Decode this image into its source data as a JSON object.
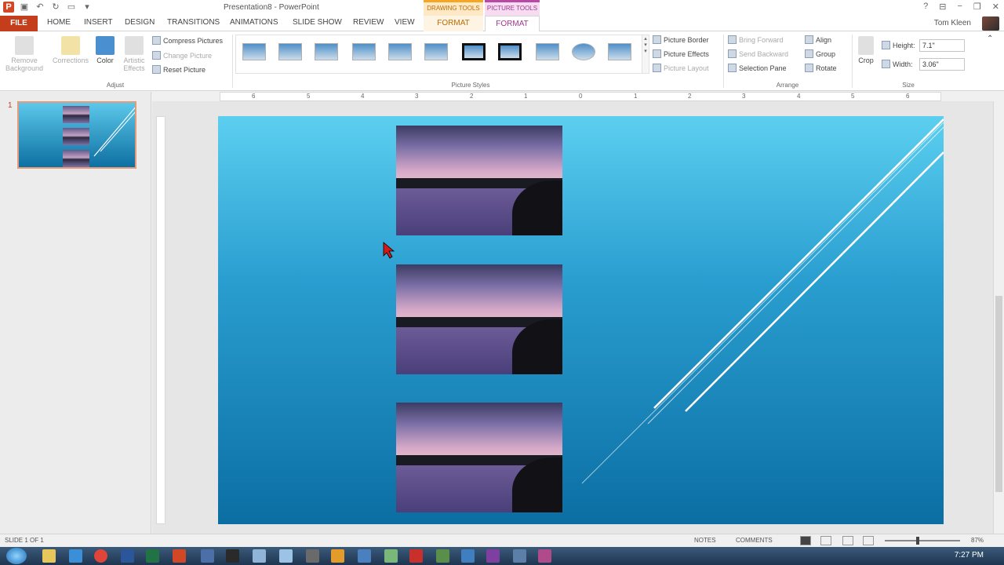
{
  "title_bar": {
    "window_title": "Presentation8 - PowerPoint",
    "ctx_drawing_tools": "DRAWING TOOLS",
    "ctx_picture_tools": "PICTURE TOOLS",
    "help": "?",
    "minimize": "−",
    "restore": "❐",
    "close": "✕"
  },
  "tabs": {
    "file": "FILE",
    "home": "HOME",
    "insert": "INSERT",
    "design": "DESIGN",
    "transitions": "TRANSITIONS",
    "animations": "ANIMATIONS",
    "slide_show": "SLIDE SHOW",
    "review": "REVIEW",
    "view": "VIEW",
    "format_drawing": "FORMAT",
    "format_picture": "FORMAT",
    "user_name": "Tom Kleen"
  },
  "ribbon": {
    "adjust": {
      "remove_background": "Remove Background",
      "corrections": "Corrections",
      "color": "Color",
      "artistic_effects": "Artistic Effects",
      "compress_pictures": "Compress Pictures",
      "change_picture": "Change Picture",
      "reset_picture": "Reset Picture",
      "label": "Adjust"
    },
    "picture_styles": {
      "label": "Picture Styles",
      "picture_border": "Picture Border",
      "picture_effects": "Picture Effects",
      "picture_layout": "Picture Layout"
    },
    "arrange": {
      "label": "Arrange",
      "bring_forward": "Bring Forward",
      "send_backward": "Send Backward",
      "selection_pane": "Selection Pane",
      "align": "Align",
      "group": "Group",
      "rotate": "Rotate"
    },
    "size": {
      "label": "Size",
      "crop": "Crop",
      "height_label": "Height:",
      "height_value": "7.1\"",
      "width_label": "Width:",
      "width_value": "3.06\""
    }
  },
  "ruler": {
    "h_ticks": [
      "6",
      "5",
      "4",
      "3",
      "2",
      "1",
      "0",
      "1",
      "2",
      "3",
      "4",
      "5",
      "6"
    ]
  },
  "thumbnails": {
    "slide_number": "1"
  },
  "status_bar": {
    "slide_count": "SLIDE 1 OF 1",
    "notes": "NOTES",
    "comments": "COMMENTS",
    "zoom": "87%"
  },
  "taskbar": {
    "clock": "7:27 PM"
  },
  "colors": {
    "accent_file": "#c43e1c",
    "slide_top": "#5ccff0",
    "slide_bottom": "#0b6ea3",
    "picture_tools": "#a0368f",
    "drawing_tools": "#c06a00"
  }
}
